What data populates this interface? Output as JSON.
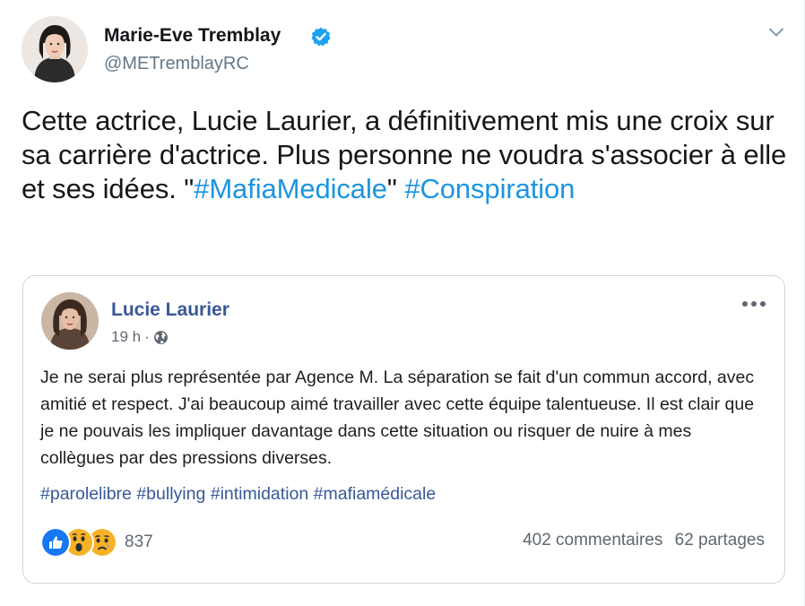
{
  "tweet": {
    "author_name": "Marie-Eve Tremblay",
    "handle": "@METremblayRC",
    "verified": true,
    "text_part1": "Cette actrice, Lucie Laurier, a définitivement mis une croix sur sa carrière d'actrice. Plus personne ne voudra s'associer à elle et ses idées. \"",
    "hashtag1": "#MafiaMedicale",
    "text_part2": "\" ",
    "hashtag2": "#Conspiration"
  },
  "embedded_post": {
    "author_name": "Lucie Laurier",
    "time": "19 h",
    "separator": "·",
    "audience_icon": "globe-icon",
    "menu_icon": "more-dots-icon",
    "body": "Je ne serai plus représentée par Agence M. La séparation se fait d'un commun accord, avec amitié et respect. J'ai beaucoup aimé travailler avec cette équipe talentueuse. Il est clair que je ne pouvais les impliquer davantage dans cette situation ou risquer de nuire à mes collègues par des pressions diverses.",
    "hashtags": [
      "#parolelibre",
      "#bullying",
      "#intimidation",
      "#mafiamédicale"
    ],
    "reactions": [
      "like-icon",
      "wow-icon",
      "sad-icon"
    ],
    "reaction_count": "837",
    "comments": "402 commentaires",
    "shares": "62 partages"
  },
  "colors": {
    "twitter_link": "#1b95e0",
    "facebook_link": "#385898",
    "verified_badge": "#1da1f2",
    "like_blue": "#1877f2",
    "emoji_yellow": "#f7b125"
  }
}
